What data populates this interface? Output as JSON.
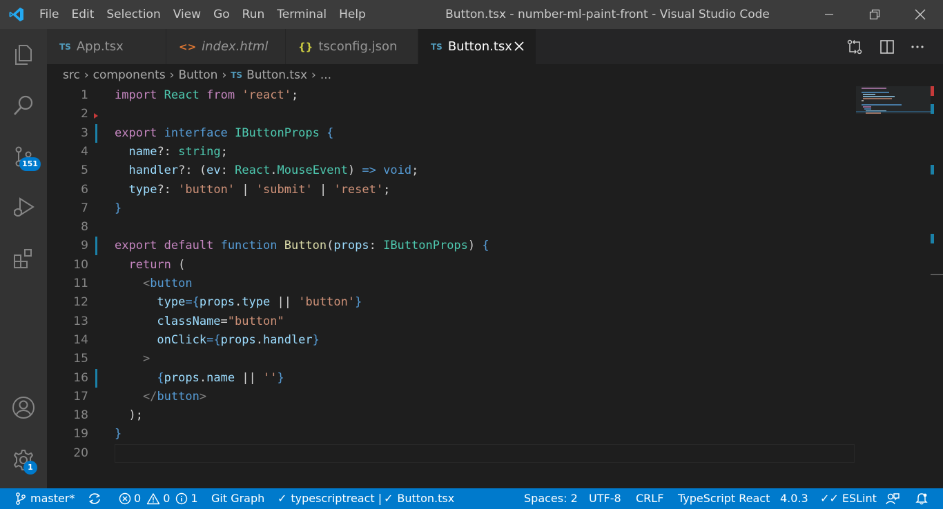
{
  "titlebar": {
    "menu": [
      "File",
      "Edit",
      "Selection",
      "View",
      "Go",
      "Run",
      "Terminal",
      "Help"
    ],
    "title": "Button.tsx - number-ml-paint-front - Visual Studio Code"
  },
  "activity": {
    "scm_badge": "151",
    "settings_badge": "1"
  },
  "tabs": [
    {
      "icon": "TS",
      "label": "App.tsx"
    },
    {
      "icon": "<>",
      "label": "index.html"
    },
    {
      "icon": "{}",
      "label": "tsconfig.json"
    },
    {
      "icon": "TS",
      "label": "Button.tsx"
    }
  ],
  "breadcrumb": {
    "parts": [
      "src",
      "components",
      "Button"
    ],
    "file_icon": "TS",
    "file": "Button.tsx",
    "more": "..."
  },
  "editor": {
    "line_numbers": [
      "1",
      "2",
      "3",
      "4",
      "5",
      "6",
      "7",
      "8",
      "9",
      "10",
      "11",
      "12",
      "13",
      "14",
      "15",
      "16",
      "17",
      "18",
      "19",
      "20"
    ],
    "lines": [
      "import React from 'react';",
      "",
      "export interface IButtonProps {",
      "  name?: string;",
      "  handler?: (ev: React.MouseEvent) => void;",
      "  type?: 'button' | 'submit' | 'reset';",
      "}",
      "",
      "export default function Button(props: IButtonProps) {",
      "  return (",
      "    <button",
      "      type={props.type || 'button'}",
      "      className=\"button\"",
      "      onClick={props.handler}",
      "    >",
      "      {props.name || ''}",
      "    </button>",
      "  );",
      "}",
      ""
    ]
  },
  "statusbar": {
    "branch": "master*",
    "errors": "0",
    "warnings": "0",
    "infos": "1",
    "git_graph": "Git Graph",
    "lang_check": "typescriptreact |",
    "file_check": "Button.tsx",
    "spaces": "Spaces: 2",
    "encoding": "UTF-8",
    "eol": "CRLF",
    "language": "TypeScript React",
    "version": "4.0.3",
    "eslint": "ESLint"
  },
  "colors": {
    "accent": "#007acc",
    "keyword": "#c586c0",
    "storage": "#569cd6",
    "type": "#4ec9b0",
    "variable": "#9cdcfe",
    "function": "#dcdcaa",
    "string": "#ce9178"
  }
}
